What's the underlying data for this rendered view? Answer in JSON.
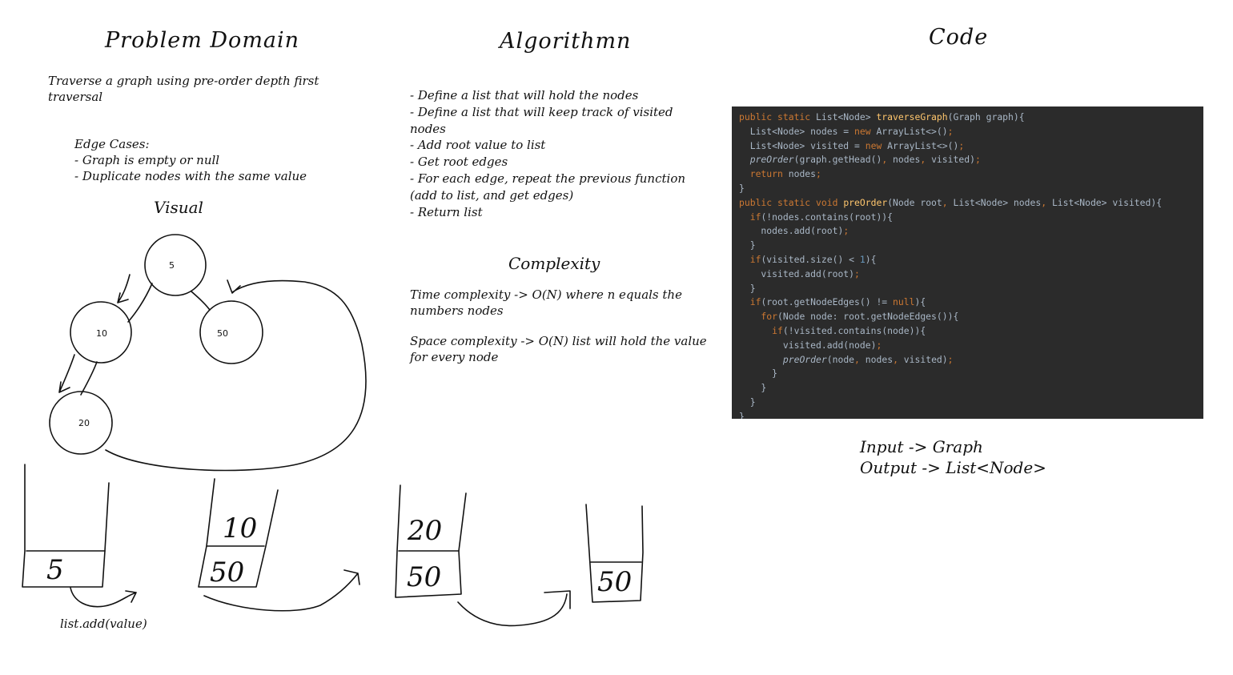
{
  "headers": {
    "problem_domain": "Problem Domain",
    "algorithm": "Algorithmn",
    "code": "Code"
  },
  "problem": {
    "description": [
      "Traverse a graph using pre-order depth first",
      "traversal"
    ],
    "edge_cases_title": "Edge Cases:",
    "edge_cases": [
      "- Graph is empty or null",
      "- Duplicate nodes with the same value"
    ]
  },
  "visual": {
    "title": "Visual",
    "nodes": [
      "5",
      "10",
      "50",
      "20"
    ],
    "stacks": [
      {
        "top": "",
        "bottom": "5"
      },
      {
        "top": "10",
        "bottom": "50"
      },
      {
        "top": "20",
        "bottom": "50"
      },
      {
        "top": "",
        "bottom": "50"
      }
    ],
    "caption": "list.add(value)"
  },
  "algorithm": {
    "steps": [
      "- Define a list that will hold the nodes",
      "- Define a list that will keep track of visited",
      "nodes",
      "- Add root value to list",
      "- Get root edges",
      "- For each edge, repeat the previous function",
      "(add to list, and get edges)",
      "- Return list"
    ]
  },
  "complexity": {
    "title": "Complexity",
    "time": [
      "Time complexity -> O(N) where n equals the",
      "numbers nodes"
    ],
    "space": [
      "Space complexity -> O(N) list will hold the value",
      "for every node"
    ]
  },
  "code": {
    "lines": [
      [
        [
          "kw",
          "public static "
        ],
        [
          "pl",
          "List<Node> "
        ],
        [
          "fn",
          "traverseGraph"
        ],
        [
          "pl",
          "(Graph graph){"
        ]
      ],
      [
        [
          "pl",
          "  List<Node> nodes = "
        ],
        [
          "kw",
          "new "
        ],
        [
          "pl",
          "ArrayList<>()"
        ],
        [
          "kw",
          ";"
        ]
      ],
      [
        [
          "pl",
          "  List<Node> visited = "
        ],
        [
          "kw",
          "new "
        ],
        [
          "pl",
          "ArrayList<>()"
        ],
        [
          "kw",
          ";"
        ]
      ],
      [
        [
          "pl",
          "  "
        ],
        [
          "it",
          "preOrder"
        ],
        [
          "pl",
          "(graph.getHead()"
        ],
        [
          "kw",
          ", "
        ],
        [
          "pl",
          "nodes"
        ],
        [
          "kw",
          ", "
        ],
        [
          "pl",
          "visited)"
        ],
        [
          "kw",
          ";"
        ]
      ],
      [
        [
          "kw",
          "  return "
        ],
        [
          "pl",
          "nodes"
        ],
        [
          "kw",
          ";"
        ]
      ],
      [
        [
          "pl",
          "}"
        ]
      ],
      [
        [
          "kw",
          "public static void "
        ],
        [
          "fn",
          "preOrder"
        ],
        [
          "pl",
          "(Node root"
        ],
        [
          "kw",
          ", "
        ],
        [
          "pl",
          "List<Node> nodes"
        ],
        [
          "kw",
          ", "
        ],
        [
          "pl",
          "List<Node> visited){"
        ]
      ],
      [
        [
          "kw",
          "  if"
        ],
        [
          "pl",
          "(!nodes.contains(root)){"
        ]
      ],
      [
        [
          "pl",
          "    nodes.add(root)"
        ],
        [
          "kw",
          ";"
        ]
      ],
      [
        [
          "pl",
          "  }"
        ]
      ],
      [
        [
          "kw",
          "  if"
        ],
        [
          "pl",
          "(visited.size() < "
        ],
        [
          "num",
          "1"
        ],
        [
          "pl",
          "){"
        ]
      ],
      [
        [
          "pl",
          "    visited.add(root)"
        ],
        [
          "kw",
          ";"
        ]
      ],
      [
        [
          "pl",
          "  }"
        ]
      ],
      [
        [
          "kw",
          "  if"
        ],
        [
          "pl",
          "(root.getNodeEdges() != "
        ],
        [
          "kw",
          "null"
        ],
        [
          "pl",
          "){"
        ]
      ],
      [
        [
          "kw",
          "    for"
        ],
        [
          "pl",
          "(Node node: root.getNodeEdges()){"
        ]
      ],
      [
        [
          "kw",
          "      if"
        ],
        [
          "pl",
          "(!visited.contains(node)){"
        ]
      ],
      [
        [
          "pl",
          "        visited.add(node)"
        ],
        [
          "kw",
          ";"
        ]
      ],
      [
        [
          "pl",
          "        "
        ],
        [
          "it",
          "preOrder"
        ],
        [
          "pl",
          "(node"
        ],
        [
          "kw",
          ", "
        ],
        [
          "pl",
          "nodes"
        ],
        [
          "kw",
          ", "
        ],
        [
          "pl",
          "visited)"
        ],
        [
          "kw",
          ";"
        ]
      ],
      [
        [
          "pl",
          "      }"
        ]
      ],
      [
        [
          "pl",
          "    }"
        ]
      ],
      [
        [
          "pl",
          "  }"
        ]
      ],
      [
        [
          "pl",
          "}"
        ]
      ]
    ]
  },
  "io": {
    "input": "Input -> Graph",
    "output": "Output -> List<Node>"
  }
}
